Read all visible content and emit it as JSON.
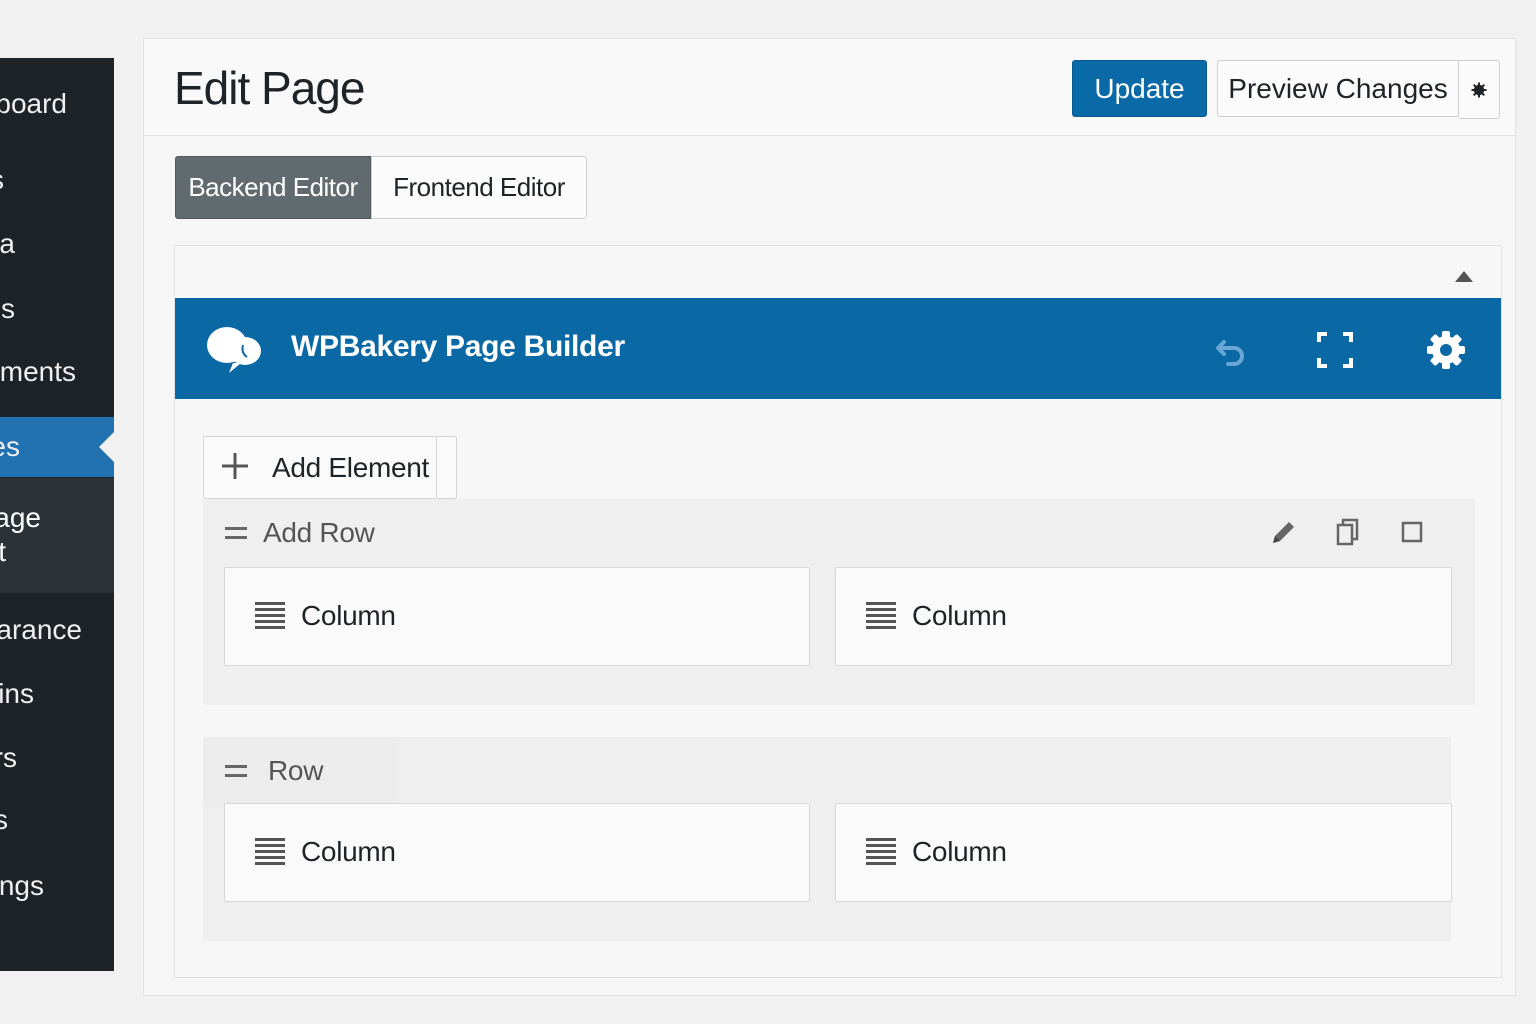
{
  "sidebar": {
    "items": [
      {
        "label": "board"
      },
      {
        "label": "s"
      },
      {
        "label": "a"
      },
      {
        "label": "s"
      },
      {
        "label": "ments"
      },
      {
        "label": "es"
      },
      {
        "label": "arance"
      },
      {
        "label": "ins"
      },
      {
        "label": "rs"
      },
      {
        "label": "s"
      },
      {
        "label": "ngs"
      }
    ],
    "submenu": [
      "age",
      "t"
    ]
  },
  "header": {
    "title": "Edit Page",
    "update_label": "Update",
    "preview_label": "Preview Changes"
  },
  "editor_tabs": {
    "backend": "Backend Editor",
    "frontend": "Frontend Editor"
  },
  "builder": {
    "title": "WPBakery Page Builder",
    "add_element_label": "Add Element",
    "rows": [
      {
        "label": "Add Row",
        "columns": [
          "Column",
          "Column"
        ]
      },
      {
        "label": "Row",
        "columns": [
          "Column",
          "Column"
        ]
      }
    ]
  },
  "colors": {
    "accent": "#0a69a5",
    "sidebar_bg": "#1d2327",
    "sidebar_current": "#2271b1"
  },
  "icons": [
    "gear-icon",
    "undo-icon",
    "fullscreen-icon",
    "pencil-icon",
    "copy-icon",
    "square-icon",
    "plus-icon",
    "drag-handle-icon",
    "column-lines-icon",
    "speech-bubbles-logo"
  ]
}
